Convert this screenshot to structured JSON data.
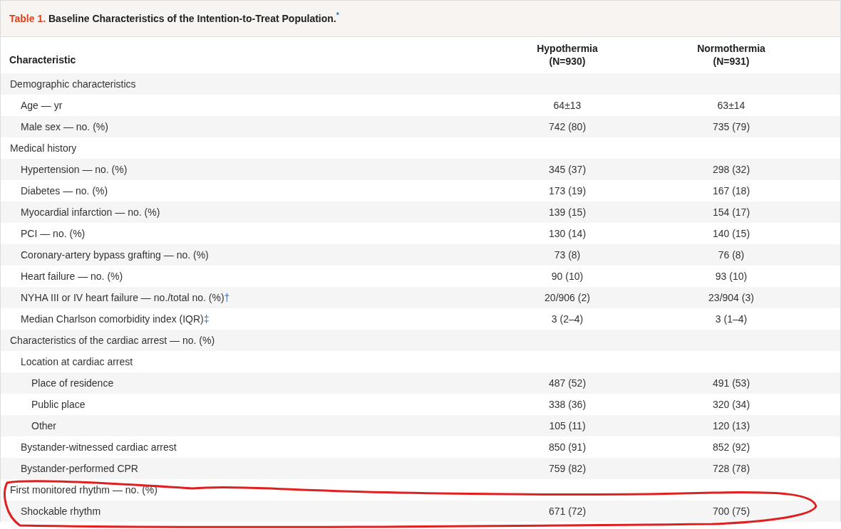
{
  "table_title": {
    "label": "Table 1.",
    "text": "Baseline Characteristics of the Intention-to-Treat Population.",
    "note_mark": "*"
  },
  "columns": [
    {
      "label": "Characteristic"
    },
    {
      "label": "Hypothermia",
      "sublabel": "(N=930)"
    },
    {
      "label": "Normothermia",
      "sublabel": "(N=931)"
    }
  ],
  "rows": [
    {
      "label": "Demographic characteristics",
      "children": [
        {
          "label": "Age — yr",
          "values": [
            "64±13",
            "63±14"
          ]
        },
        {
          "label": "Male sex — no. (%)",
          "values": [
            "742 (80)",
            "735 (79)"
          ]
        }
      ]
    },
    {
      "label": "Medical history",
      "children": [
        {
          "label": "Hypertension — no. (%)",
          "values": [
            "345 (37)",
            "298 (32)"
          ]
        },
        {
          "label": "Diabetes — no. (%)",
          "values": [
            "173 (19)",
            "167 (18)"
          ]
        },
        {
          "label": "Myocardial infarction — no. (%)",
          "values": [
            "139 (15)",
            "154 (17)"
          ]
        },
        {
          "label": "PCI — no. (%)",
          "values": [
            "130 (14)",
            "140 (15)"
          ]
        },
        {
          "label": "Coronary-artery bypass grafting — no. (%)",
          "values": [
            "73 (8)",
            "76 (8)"
          ]
        },
        {
          "label": "Heart failure — no. (%)",
          "values": [
            "90 (10)",
            "93 (10)"
          ]
        },
        {
          "label": "NYHA III or IV heart failure — no./total no. (%)",
          "note_mark": "†",
          "values": [
            "20/906 (2)",
            "23/904 (3)"
          ]
        },
        {
          "label": "Median Charlson comorbidity index (IQR)",
          "note_mark": "‡",
          "values": [
            "3 (2–4)",
            "3 (1–4)"
          ]
        }
      ]
    },
    {
      "label": "Characteristics of the cardiac arrest — no. (%)",
      "children": [
        {
          "label": "Location at cardiac arrest",
          "children": [
            {
              "label": "Place of residence",
              "values": [
                "487 (52)",
                "491 (53)"
              ]
            },
            {
              "label": "Public place",
              "values": [
                "338 (36)",
                "320 (34)"
              ]
            },
            {
              "label": "Other",
              "values": [
                "105 (11)",
                "120 (13)"
              ]
            }
          ]
        },
        {
          "label": "Bystander-witnessed cardiac arrest",
          "values": [
            "850 (91)",
            "852 (92)"
          ]
        },
        {
          "label": "Bystander-performed CPR",
          "values": [
            "759 (82)",
            "728 (78)"
          ]
        }
      ]
    },
    {
      "label": "First monitored rhythm — no. (%)",
      "children": [
        {
          "label": "Shockable rhythm",
          "values": [
            "671 (72)",
            "700 (75)"
          ]
        }
      ]
    }
  ],
  "annotation": {
    "kind": "ellipse",
    "color": "#e02020"
  }
}
